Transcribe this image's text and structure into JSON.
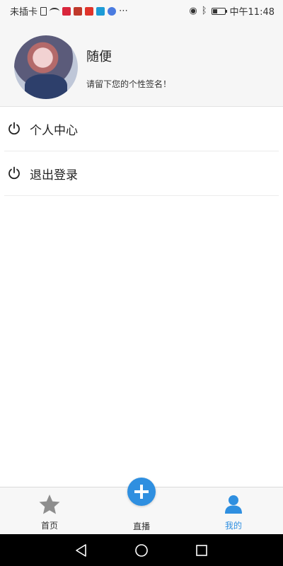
{
  "status_bar": {
    "carrier": "未插卡",
    "time": "中午11:48",
    "icons": [
      "sim-icon",
      "wifi-icon",
      "app-icons",
      "more-icon",
      "eye-icon",
      "bluetooth-icon",
      "battery-icon"
    ]
  },
  "profile": {
    "username": "随便",
    "signature": "请留下您的个性签名！"
  },
  "menu": {
    "items": [
      {
        "label": "个人中心",
        "icon": "power-icon"
      },
      {
        "label": "退出登录",
        "icon": "power-icon"
      }
    ]
  },
  "tabbar": {
    "tabs": [
      {
        "label": "首页",
        "icon": "star-icon",
        "active": false
      },
      {
        "label": "直播",
        "icon": "plus-icon",
        "active": false
      },
      {
        "label": "我的",
        "icon": "user-icon",
        "active": true
      }
    ],
    "active_color": "#2f8fe0"
  },
  "navbar": {
    "buttons": [
      "back-icon",
      "home-icon",
      "recent-apps-icon"
    ]
  }
}
